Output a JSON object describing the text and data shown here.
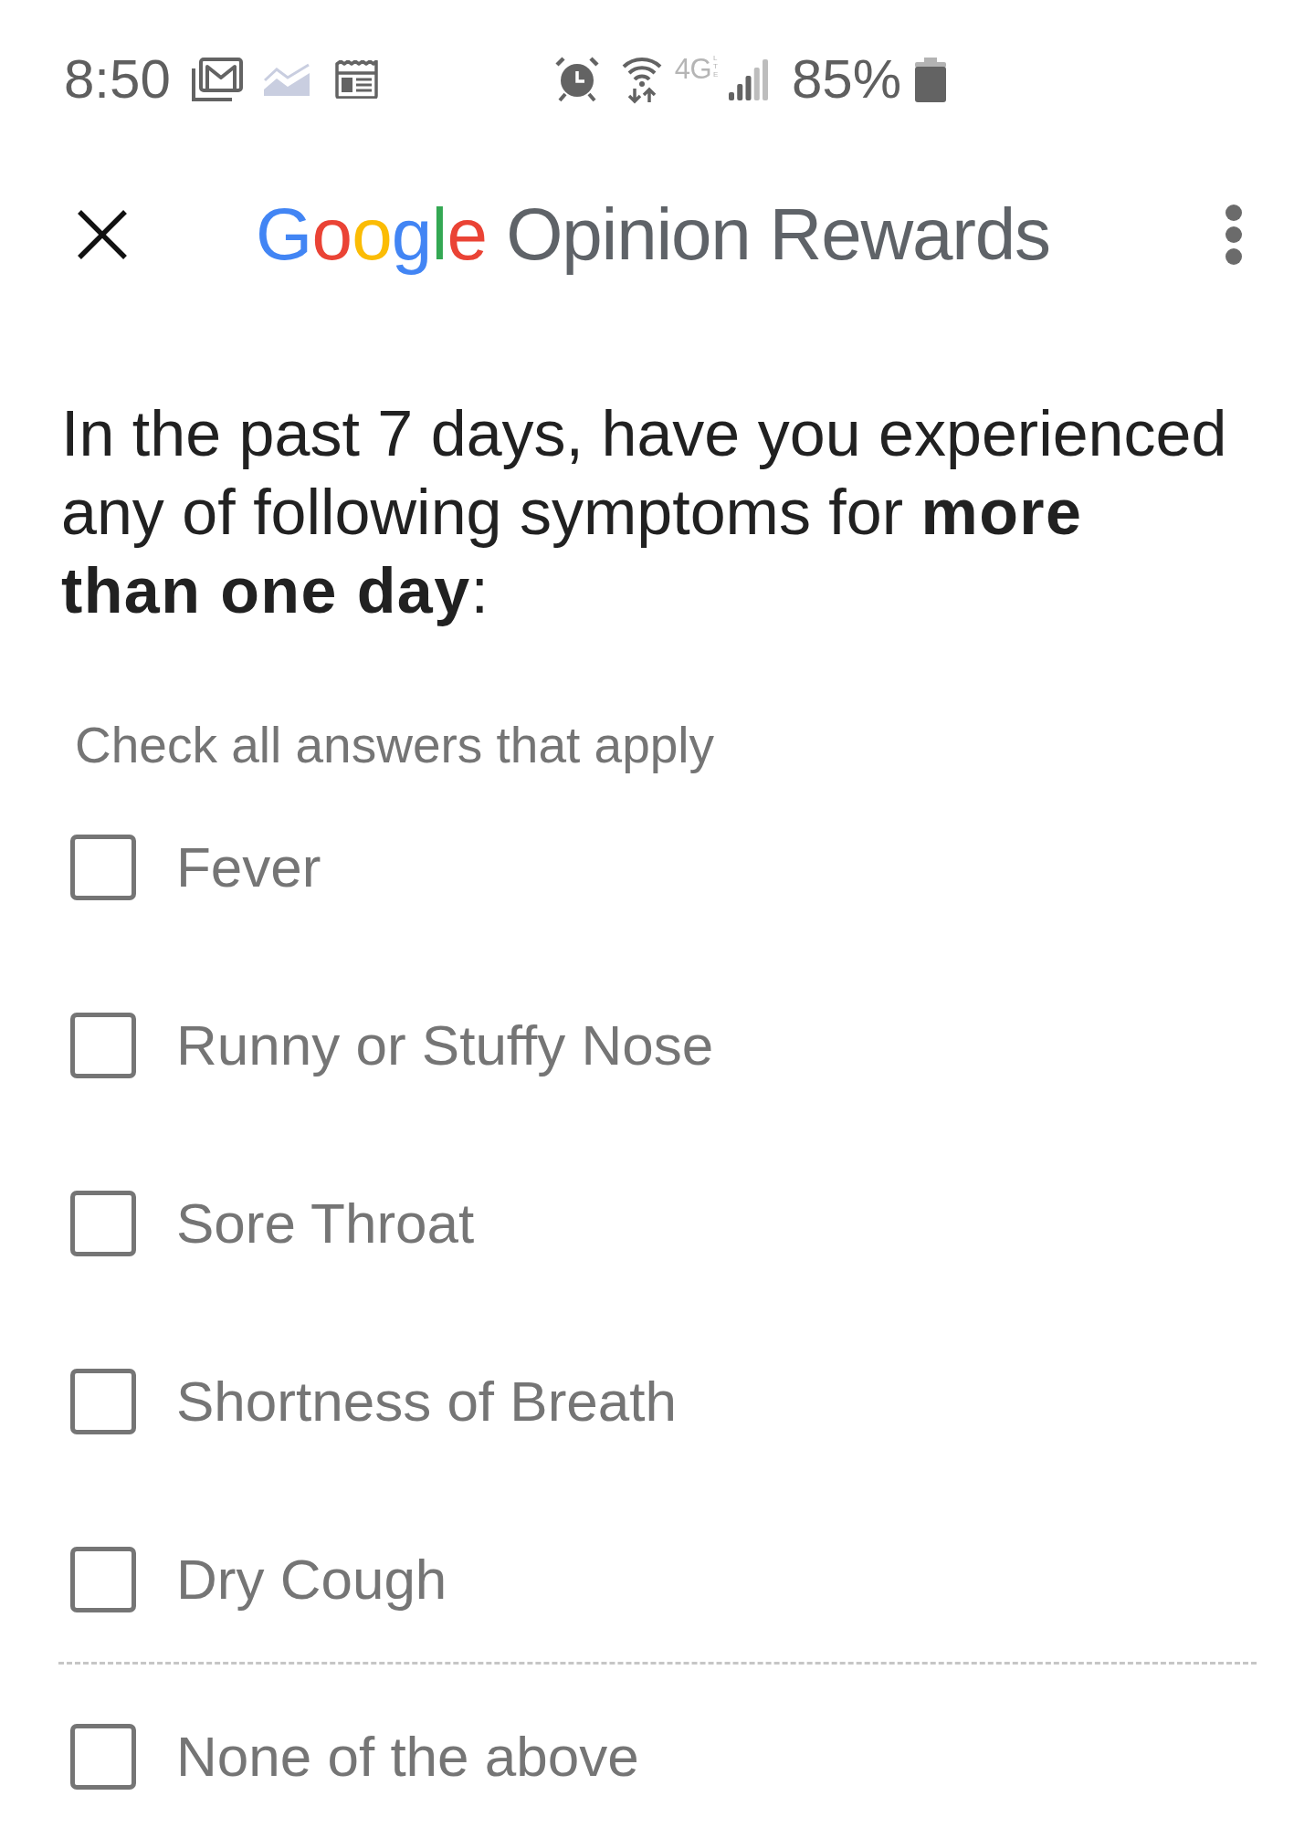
{
  "status_bar": {
    "time": "8:50",
    "network_type": "4G",
    "network_sub": "LTE",
    "battery": "85%"
  },
  "app_bar": {
    "brand": "Google",
    "title": "Opinion Rewards"
  },
  "question": {
    "text": "In the past 7 days, have you experienced any of following symptoms for **more than one day**:",
    "instruction": "Check all answers that apply"
  },
  "options": [
    {
      "label": "Fever",
      "kind": "symptom",
      "checked": false
    },
    {
      "label": "Runny or Stuffy Nose",
      "kind": "symptom",
      "checked": false
    },
    {
      "label": "Sore Throat",
      "kind": "symptom",
      "checked": false
    },
    {
      "label": "Shortness of Breath",
      "kind": "symptom",
      "checked": false
    },
    {
      "label": "Dry Cough",
      "kind": "symptom",
      "checked": false
    },
    {
      "label": "None of the above",
      "kind": "exclusive",
      "checked": false
    }
  ]
}
